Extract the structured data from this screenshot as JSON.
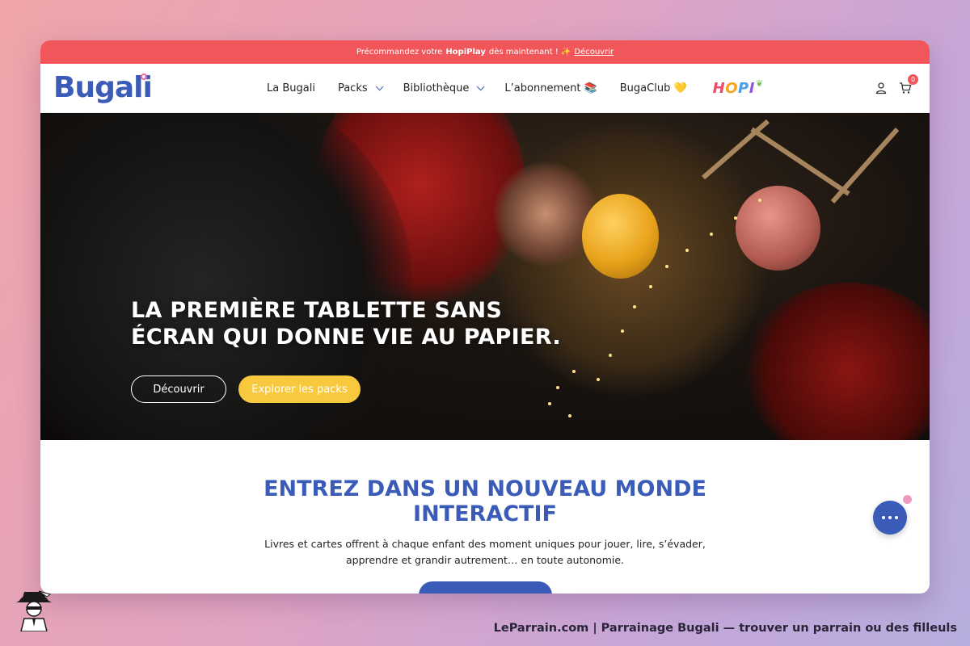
{
  "promo": {
    "text_before": "Précommandez votre",
    "product": "HopiPlay",
    "text_after": "dès maintenant ! ✨",
    "link": "Découvrir"
  },
  "header": {
    "logo": "Bugali",
    "menu": [
      {
        "label": "La Bugali"
      },
      {
        "label": "Packs"
      },
      {
        "label": "Bibliothèque"
      },
      {
        "label": "L’abonnement 📚"
      },
      {
        "label": "BugaClub 💛"
      }
    ],
    "hopi_logo": "HOPI",
    "cart_count": "0"
  },
  "hero": {
    "title_line1": "LA PREMIÈRE TABLETTE SANS",
    "title_line2": "ÉCRAN QUI DONNE VIE AU PAPIER.",
    "btn_discover": "Découvrir",
    "btn_packs": "Explorer les packs"
  },
  "section": {
    "title_line1": "ENTREZ DANS UN NOUVEAU MONDE",
    "title_line2": "INTERACTIF",
    "text_line1": "Livres et cartes offrent à chaque enfant des moment uniques pour jouer, lire, s’évader,",
    "text_line2": "apprendre et grandir autrement… en toute autonomie."
  },
  "footer": {
    "caption": "LeParrain.com | Parrainage Bugali — trouver un parrain ou des filleuls"
  },
  "colors": {
    "brand_blue": "#3a5cb8",
    "promo_red": "#f0565a",
    "accent_yellow": "#f8c93e"
  },
  "icons": [
    "user-icon",
    "cart-icon",
    "chevron-down-icon",
    "chat-icon"
  ]
}
